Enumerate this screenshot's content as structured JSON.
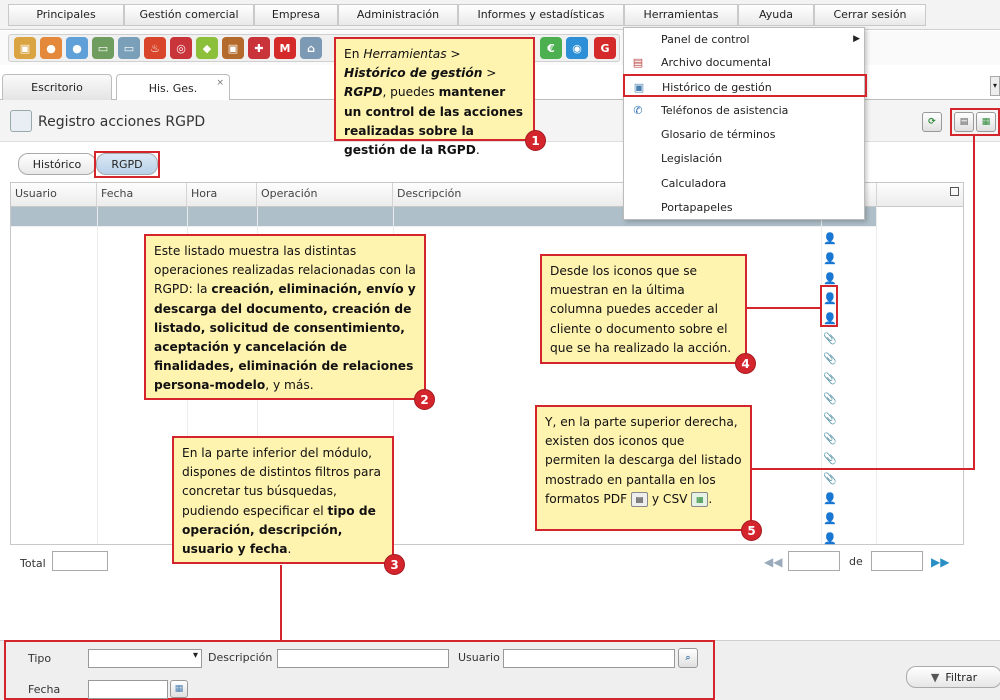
{
  "menu": {
    "items": [
      "Principales",
      "Gestión comercial",
      "Empresa",
      "Administración",
      "Informes y estadísticas",
      "Herramientas",
      "Ayuda",
      "Cerrar sesión"
    ]
  },
  "tabs": [
    {
      "label": "Escritorio"
    },
    {
      "label": "His. Ges.",
      "close": "×"
    }
  ],
  "module": {
    "title": "Registro acciones RGPD",
    "subtabs": [
      "Histórico",
      "RGPD"
    ]
  },
  "grid": {
    "columns": [
      "Usuario",
      "Fecha",
      "Hora",
      "Operación",
      "Descripción"
    ],
    "row_icons": [
      "person-icon",
      "person-icon",
      "person-icon",
      "person-icon",
      "person-icon",
      "paperclip-icon",
      "paperclip-icon",
      "paperclip-icon",
      "paperclip-icon",
      "paperclip-icon",
      "paperclip-icon",
      "paperclip-icon",
      "paperclip-icon",
      "person-icon",
      "person-icon",
      "person-icon"
    ]
  },
  "footer": {
    "total_label": "Total",
    "of_label": "de"
  },
  "filters": {
    "tipo_label": "Tipo",
    "descripcion_label": "Descripción",
    "usuario_label": "Usuario",
    "fecha_label": "Fecha",
    "filter_button": "Filtrar"
  },
  "dropdown": {
    "items": [
      {
        "label": "Panel de control",
        "submenu": "▶"
      },
      {
        "label": "Archivo documental"
      },
      {
        "label": "Histórico de gestión"
      },
      {
        "label": "Teléfonos de asistencia"
      },
      {
        "label": "Glosario de términos"
      },
      {
        "label": "Legislación"
      },
      {
        "label": "Calculadora"
      },
      {
        "label": "Portapapeles"
      }
    ]
  },
  "notes": {
    "n1": {
      "p1": "En ",
      "p2": "Herramientas",
      "p3": " > ",
      "p4": "Histórico de gestión",
      "p5": " > ",
      "p6": "RGPD",
      "p7": ", puedes ",
      "p8": "mantener un control de las acciones realizadas sobre la gestión de la RGPD",
      "p9": ".",
      "badge": "1"
    },
    "n2": {
      "p1": "Este listado muestra las distintas operaciones realizadas relacionadas con la RGPD: la ",
      "p2": "creación, eliminación, envío y descarga del documento, creación de listado, solicitud de consentimiento, aceptación y cancelación de finalidades, eliminación de relaciones persona-modelo",
      "p3": ", y más.",
      "badge": "2"
    },
    "n3": {
      "p1": "En la parte inferior del módulo, dispones de distintos filtros para concretar tus búsquedas, pudiendo especificar el ",
      "p2": "tipo de operación, descripción, usuario y fecha",
      "p3": ".",
      "badge": "3"
    },
    "n4": {
      "text": "Desde los iconos que se muestran en la última columna puedes acceder al cliente o documento sobre el que se ha realizado la acción.",
      "badge": "4"
    },
    "n5": {
      "p1": "Y, en la parte superior derecha, existen dos iconos que permiten la descarga del listado mostrado en pantalla en los formatos PDF ",
      "p2": " y CSV ",
      "p3": ".",
      "badge": "5"
    }
  },
  "colors": {
    "accent_red": "#d4242c",
    "note_bg": "#fff3b0",
    "selected_row": "#aebfc9"
  }
}
